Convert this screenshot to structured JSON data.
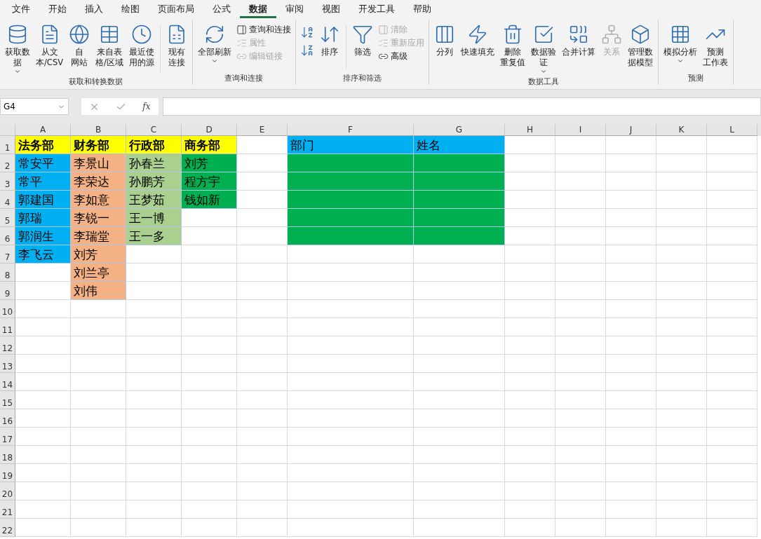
{
  "tabs": [
    {
      "label": "文件",
      "selected": false
    },
    {
      "label": "开始",
      "selected": false
    },
    {
      "label": "插入",
      "selected": false
    },
    {
      "label": "绘图",
      "selected": false
    },
    {
      "label": "页面布局",
      "selected": false
    },
    {
      "label": "公式",
      "selected": false
    },
    {
      "label": "数据",
      "selected": true
    },
    {
      "label": "审阅",
      "selected": false
    },
    {
      "label": "视图",
      "selected": false
    },
    {
      "label": "开发工具",
      "selected": false
    },
    {
      "label": "帮助",
      "selected": false
    }
  ],
  "groups": [
    {
      "title": "获取和转换数据",
      "items": [
        {
          "kind": "large",
          "lines": [
            "获取数",
            "据"
          ],
          "dropdown": true,
          "disabled": false
        },
        {
          "kind": "large",
          "lines": [
            "从文",
            "本/CSV"
          ],
          "dropdown": false,
          "disabled": false
        },
        {
          "kind": "large",
          "lines": [
            "自",
            "网站"
          ],
          "dropdown": false,
          "disabled": false
        },
        {
          "kind": "large",
          "lines": [
            "来自表",
            "格/区域"
          ],
          "dropdown": false,
          "disabled": false
        },
        {
          "kind": "large",
          "lines": [
            "最近使",
            "用的源"
          ],
          "dropdown": false,
          "disabled": false
        },
        {
          "kind": "separator"
        },
        {
          "kind": "large",
          "lines": [
            "现有",
            "连接"
          ],
          "dropdown": false,
          "disabled": false
        }
      ]
    },
    {
      "title": "查询和连接",
      "items": [
        {
          "kind": "large",
          "lines": [
            "全部刷新"
          ],
          "dropdown": true,
          "disabled": false
        },
        {
          "kind": "stack",
          "items": [
            {
              "label": "查询和连接",
              "disabled": false
            },
            {
              "label": "属性",
              "disabled": true
            },
            {
              "label": "编辑链接",
              "disabled": true
            }
          ]
        }
      ]
    },
    {
      "title": "排序和筛选",
      "items": [
        {
          "kind": "sort-pair"
        },
        {
          "kind": "large",
          "lines": [
            "排序"
          ],
          "dropdown": false,
          "disabled": false
        },
        {
          "kind": "separator"
        },
        {
          "kind": "large",
          "lines": [
            "筛选"
          ],
          "dropdown": false,
          "disabled": false
        },
        {
          "kind": "stack",
          "items": [
            {
              "label": "清除",
              "disabled": true
            },
            {
              "label": "重新应用",
              "disabled": true
            },
            {
              "label": "高级",
              "disabled": false
            }
          ]
        }
      ]
    },
    {
      "title": "数据工具",
      "items": [
        {
          "kind": "large",
          "lines": [
            "分列"
          ],
          "dropdown": false,
          "disabled": false
        },
        {
          "kind": "large",
          "lines": [
            "快速填充"
          ],
          "dropdown": false,
          "disabled": false
        },
        {
          "kind": "large",
          "lines": [
            "删除",
            "重复值"
          ],
          "dropdown": false,
          "disabled": false
        },
        {
          "kind": "large",
          "lines": [
            "数据验",
            "证"
          ],
          "dropdown": true,
          "disabled": false
        },
        {
          "kind": "large",
          "lines": [
            "合并计算"
          ],
          "dropdown": false,
          "disabled": false
        },
        {
          "kind": "large",
          "lines": [
            "关系"
          ],
          "dropdown": false,
          "disabled": true
        },
        {
          "kind": "large",
          "lines": [
            "管理数",
            "据模型"
          ],
          "dropdown": false,
          "disabled": false
        }
      ]
    },
    {
      "title": "预测",
      "items": [
        {
          "kind": "large",
          "lines": [
            "模拟分析"
          ],
          "dropdown": true,
          "disabled": false
        },
        {
          "kind": "large",
          "lines": [
            "预测",
            "工作表"
          ],
          "dropdown": false,
          "disabled": false
        }
      ]
    }
  ],
  "formula_bar": {
    "name_box": "G4",
    "function_label": "fx"
  },
  "sheet": {
    "columns": [
      "A",
      "B",
      "C",
      "D",
      "E",
      "F",
      "G",
      "H",
      "I",
      "J",
      "K",
      "L"
    ],
    "rows": [
      {
        "number": "1",
        "cells": [
          {
            "text": "法务部",
            "color": "#ffff00",
            "bold": true
          },
          {
            "text": "财务部",
            "color": "#ffff00",
            "bold": true
          },
          {
            "text": "行政部",
            "color": "#ffff00",
            "bold": true
          },
          {
            "text": "商务部",
            "color": "#ffff00",
            "bold": true
          },
          {},
          {
            "text": "部门",
            "color": "#00b0f0",
            "bold": false
          },
          {
            "text": "姓名",
            "color": "#00b0f0",
            "bold": false
          }
        ]
      },
      {
        "number": "2",
        "cells": [
          {
            "text": "常安平",
            "color": "#00b0f0"
          },
          {
            "text": "李景山",
            "color": "#f4b183"
          },
          {
            "text": "孙春兰",
            "color": "#a9d08e"
          },
          {
            "text": "刘芳",
            "color": "#00b050"
          },
          {},
          {
            "color": "#00b050"
          },
          {
            "color": "#00b050"
          }
        ]
      },
      {
        "number": "3",
        "cells": [
          {
            "text": "常平",
            "color": "#00b0f0"
          },
          {
            "text": "李荣达",
            "color": "#f4b183"
          },
          {
            "text": "孙鹏芳",
            "color": "#a9d08e"
          },
          {
            "text": "程方宇",
            "color": "#00b050"
          },
          {},
          {
            "color": "#00b050"
          },
          {
            "color": "#00b050"
          }
        ]
      },
      {
        "number": "4",
        "cells": [
          {
            "text": "郭建国",
            "color": "#00b0f0"
          },
          {
            "text": "李如意",
            "color": "#f4b183"
          },
          {
            "text": "王梦茹",
            "color": "#a9d08e"
          },
          {
            "text": "钱如新",
            "color": "#00b050"
          },
          {},
          {
            "color": "#00b050"
          },
          {
            "color": "#00b050"
          }
        ]
      },
      {
        "number": "5",
        "cells": [
          {
            "text": "郭瑞",
            "color": "#00b0f0"
          },
          {
            "text": "李锐一",
            "color": "#f4b183"
          },
          {
            "text": "王一博",
            "color": "#a9d08e"
          },
          {},
          {},
          {
            "color": "#00b050"
          },
          {
            "color": "#00b050"
          }
        ]
      },
      {
        "number": "6",
        "cells": [
          {
            "text": "郭润生",
            "color": "#00b0f0"
          },
          {
            "text": "李瑞堂",
            "color": "#f4b183"
          },
          {
            "text": "王一多",
            "color": "#a9d08e"
          },
          {},
          {},
          {
            "color": "#00b050"
          },
          {
            "color": "#00b050"
          }
        ]
      },
      {
        "number": "7",
        "cells": [
          {
            "text": "李飞云",
            "color": "#00b0f0"
          },
          {
            "text": "刘芳",
            "color": "#f4b183"
          }
        ]
      },
      {
        "number": "8",
        "cells": [
          {},
          {
            "text": "刘兰亭",
            "color": "#f4b183"
          }
        ]
      },
      {
        "number": "9",
        "cells": [
          {},
          {
            "text": "刘伟",
            "color": "#f4b183"
          }
        ]
      },
      {
        "number": "10",
        "cells": []
      },
      {
        "number": "11",
        "cells": []
      },
      {
        "number": "12",
        "cells": []
      },
      {
        "number": "13",
        "cells": []
      },
      {
        "number": "14",
        "cells": []
      },
      {
        "number": "15",
        "cells": []
      },
      {
        "number": "16",
        "cells": []
      },
      {
        "number": "17",
        "cells": []
      },
      {
        "number": "18",
        "cells": []
      },
      {
        "number": "19",
        "cells": []
      },
      {
        "number": "20",
        "cells": []
      },
      {
        "number": "21",
        "cells": []
      },
      {
        "number": "22",
        "cells": []
      }
    ]
  }
}
